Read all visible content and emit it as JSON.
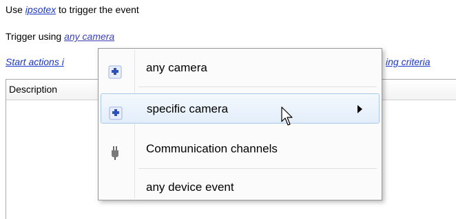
{
  "line1": {
    "prefix": "Use",
    "link": "ipsotex",
    "suffix": "to trigger the event"
  },
  "line2": {
    "prefix": "Trigger using",
    "link": "any camera"
  },
  "line3": {
    "left_link": "Start actions i",
    "right_link": "ing criteria"
  },
  "table": {
    "header": "Description"
  },
  "menu": {
    "items": [
      {
        "label": "any camera",
        "icon": "puzzle-icon"
      },
      {
        "label": "specific camera",
        "icon": "puzzle-icon",
        "submenu": true
      },
      {
        "label": "Communication channels",
        "icon": "plug-icon"
      },
      {
        "label": "any device event",
        "icon": ""
      }
    ]
  },
  "colors": {
    "link": "#1a36c8",
    "puzzle": "#2a52b8",
    "hover_border": "#a8c8eb"
  }
}
